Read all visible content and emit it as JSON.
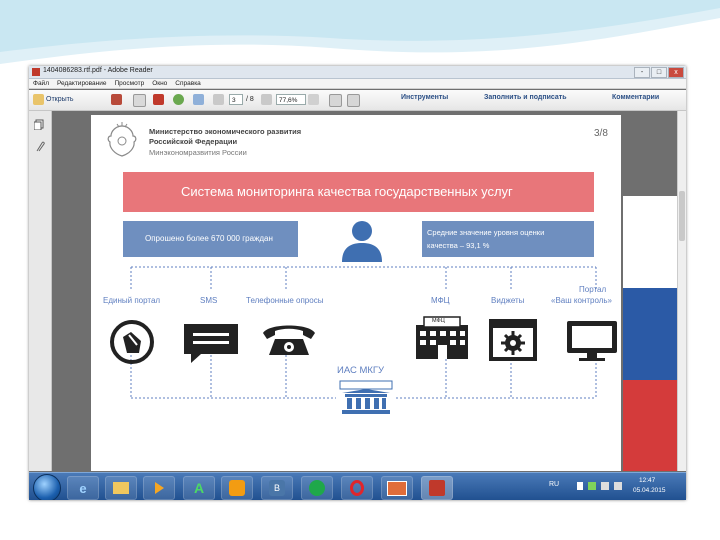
{
  "window": {
    "title": "1404086283.rtf.pdf - Adobe Reader",
    "controls": [
      "-",
      "□",
      "x"
    ]
  },
  "menu": [
    "Файл",
    "Редактирование",
    "Просмотр",
    "Окно",
    "Справка"
  ],
  "toolbar": {
    "open_label": "Открыть",
    "page_current": "3",
    "page_total": "/ 8",
    "zoom": "77,6%",
    "tools_label": "Инструменты",
    "fill_sign_label": "Заполнить и подписать",
    "comment_label": "Комментарии"
  },
  "slide": {
    "ministry_line1": "Министерство экономического развития",
    "ministry_line2": "Российской Федерации",
    "ministry_line3": "Минэкономразвития России",
    "page_number": "3/8",
    "headline": "Система мониторинга качества государственных услуг",
    "stat_left": "Опрошено более 670 000 граждан",
    "stat_right_line1": "Средние значение уровня оценки",
    "stat_right_line2": "качества – 93,1 %",
    "channels": [
      {
        "label": "Единый портал"
      },
      {
        "label": "SMS"
      },
      {
        "label": "Телефонные опросы"
      },
      {
        "label": "МФЦ"
      },
      {
        "label": "Виджеты"
      },
      {
        "label_line1": "Портал",
        "label_line2": "«Ваш контроль»"
      }
    ],
    "mfc_sign": "МФЦ",
    "center_label": "ИАС МКГУ"
  },
  "taskbar": {
    "lang": "RU",
    "time": "12:47",
    "date": "05.04.2015"
  },
  "colors": {
    "headline_bg": "#e8767a",
    "stat_bg": "#6f8fbf",
    "person_icon": "#3f6fb1",
    "line_blue": "#5f7fc0"
  }
}
